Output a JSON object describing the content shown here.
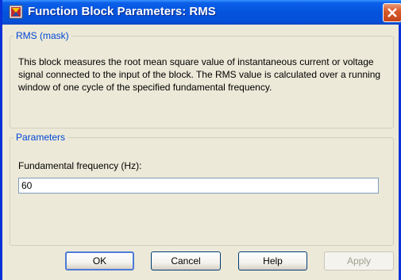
{
  "window": {
    "title": "Function Block Parameters: RMS"
  },
  "mask_group": {
    "legend": "RMS (mask)",
    "description": "This block measures the root mean square value of instantaneous current or voltage signal connected to the input of the block. The RMS value is calculated over a running window of one cycle of the specified fundamental frequency."
  },
  "parameters_group": {
    "legend": "Parameters",
    "frequency_label": "Fundamental frequency (Hz):",
    "frequency_value": "60"
  },
  "buttons": {
    "ok": "OK",
    "cancel": "Cancel",
    "help": "Help",
    "apply": "Apply"
  },
  "colors": {
    "titlebar": "#0553dd",
    "close_button": "#d95a2b",
    "dialog_background": "#ece9d8",
    "group_legend": "#0046d5"
  }
}
